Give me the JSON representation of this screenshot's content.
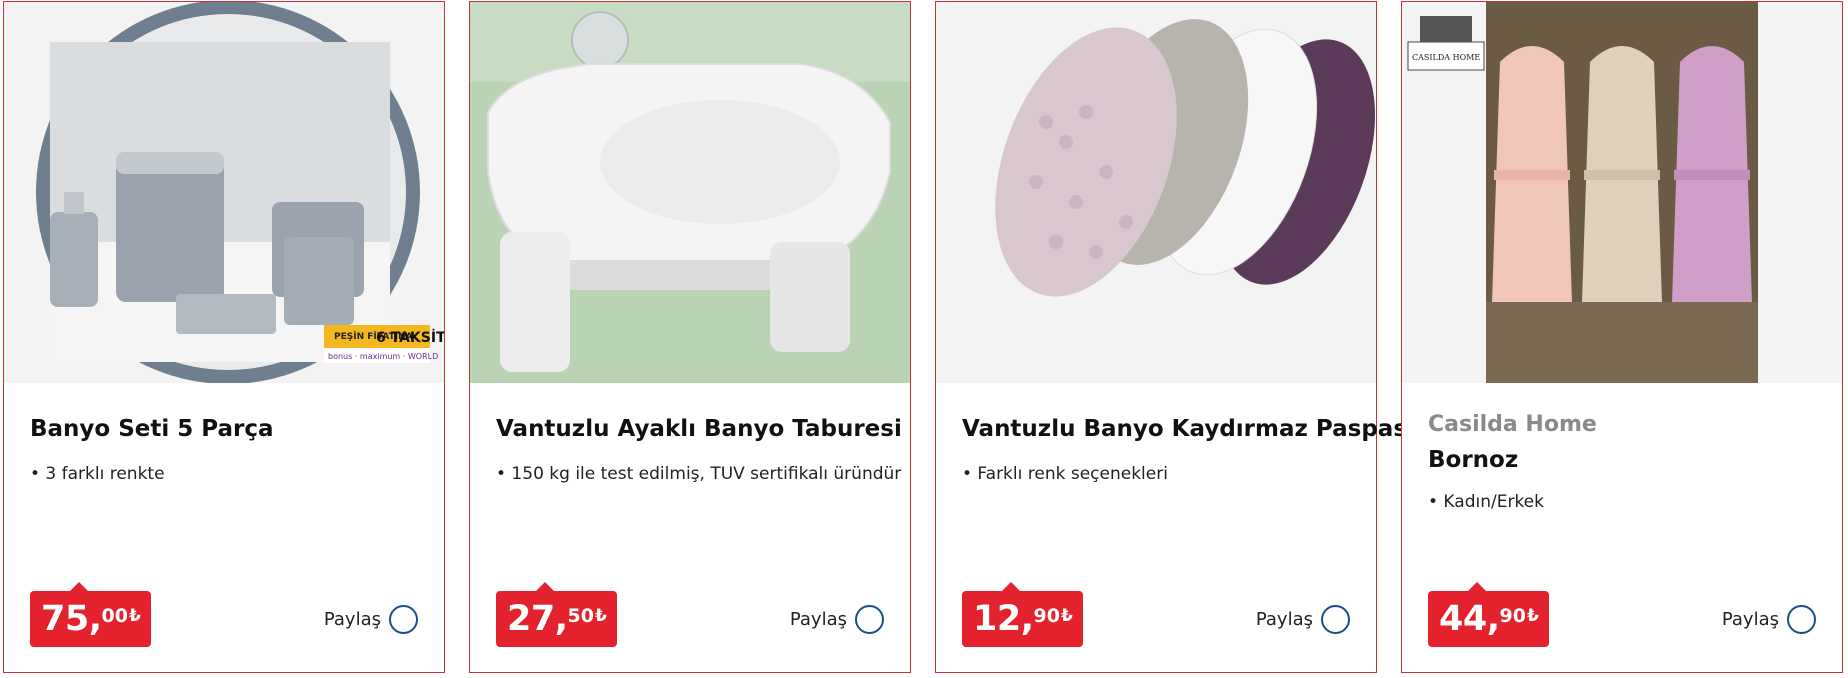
{
  "products": [
    {
      "brand": "",
      "title": "Banyo Seti 5 Parça",
      "bullet": "• 3 farklı renkte",
      "price_int": "75,",
      "price_dec": "00",
      "currency": "₺",
      "share_label": "Paylaş",
      "image_badge": {
        "line1": "PEŞİN FİYATINA",
        "line2": "6 TAKSİT",
        "banks": "bonus · maximum · WORLD"
      }
    },
    {
      "brand": "",
      "title": "Vantuzlu Ayaklı Banyo Taburesi",
      "bullet": "• 150 kg ile test edilmiş, TUV sertifikalı üründür",
      "price_int": "27,",
      "price_dec": "50",
      "currency": "₺",
      "share_label": "Paylaş"
    },
    {
      "brand": "",
      "title": "Vantuzlu Banyo Kaydırmaz Paspas",
      "bullet": "• Farklı renk seçenekleri",
      "price_int": "12,",
      "price_dec": "90",
      "currency": "₺",
      "share_label": "Paylaş"
    },
    {
      "brand": "Casilda Home",
      "title": "Bornoz",
      "bullet": "• Kadın/Erkek",
      "price_int": "44,",
      "price_dec": "90",
      "currency": "₺",
      "share_label": "Paylaş",
      "image_logo": "CASILDA HOME"
    }
  ],
  "colors": {
    "accent": "#e4222e",
    "border": "#c8333d",
    "share_circle": "#1b4f8a"
  }
}
